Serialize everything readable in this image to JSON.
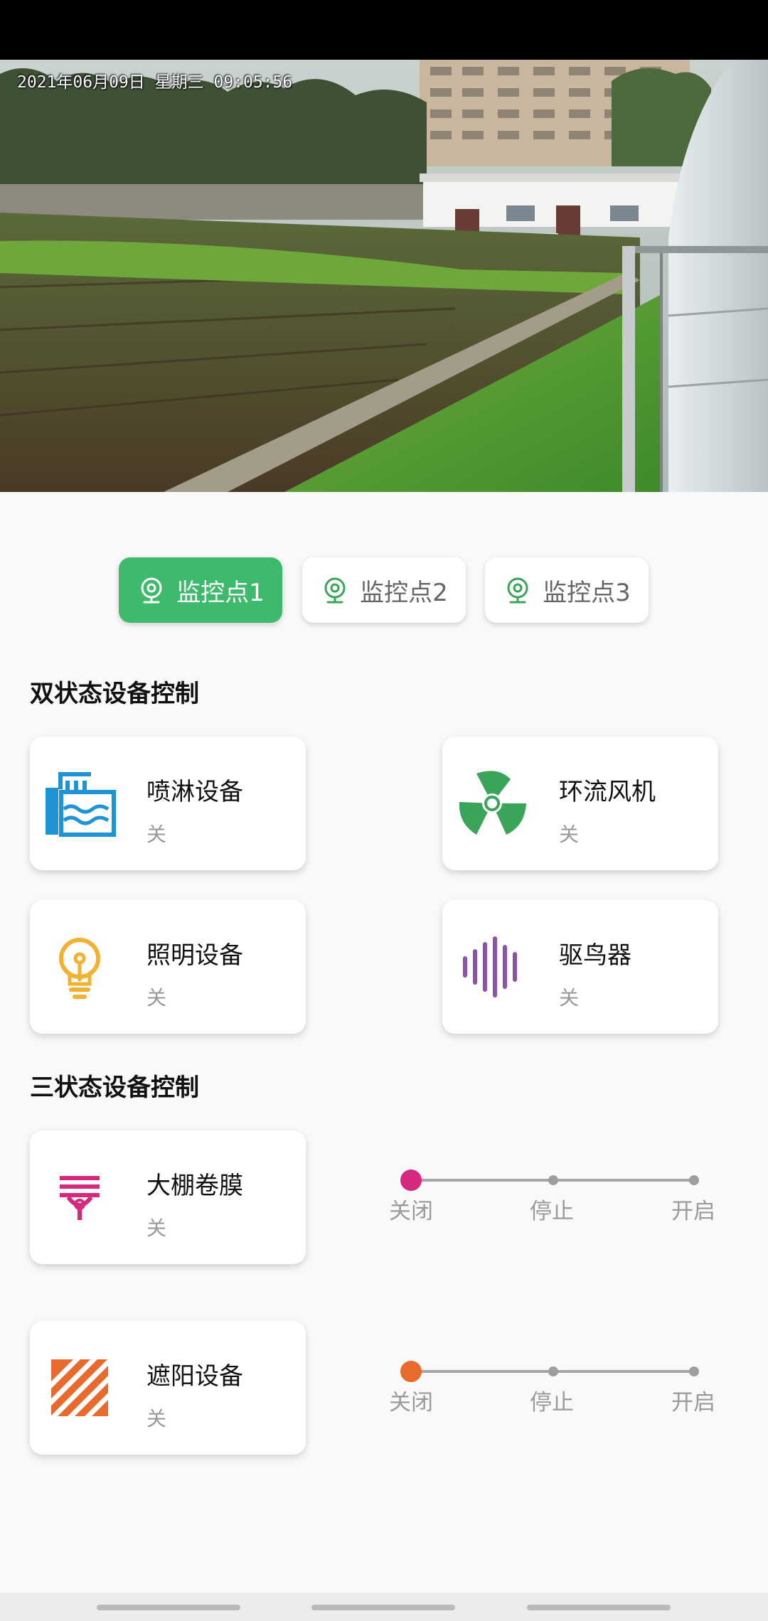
{
  "video": {
    "osd_timestamp": "2021年06月09日 星期三 09:05:56"
  },
  "camera_tabs": [
    {
      "label": "监控点1",
      "active": true,
      "icon": "webcam-icon"
    },
    {
      "label": "监控点2",
      "active": false,
      "icon": "webcam-icon"
    },
    {
      "label": "监控点3",
      "active": false,
      "icon": "webcam-icon"
    }
  ],
  "sections": {
    "two_state_title": "双状态设备控制",
    "three_state_title": "三状态设备控制"
  },
  "two_state_devices": [
    {
      "name": "喷淋设备",
      "state": "关",
      "icon": "sprinkler-icon",
      "color": "#1e93d6"
    },
    {
      "name": "环流风机",
      "state": "关",
      "icon": "fan-icon",
      "color": "#3aa559"
    },
    {
      "name": "照明设备",
      "state": "关",
      "icon": "lightbulb-icon",
      "color": "#f1b232"
    },
    {
      "name": "驱鸟器",
      "state": "关",
      "icon": "sound-wave-icon",
      "color": "#8a53a8"
    }
  ],
  "three_state_devices": [
    {
      "name": "大棚卷膜",
      "state": "关",
      "icon": "film-roll-icon",
      "color": "#d6297e",
      "options": [
        "关闭",
        "停止",
        "开启"
      ],
      "selected": "关闭"
    },
    {
      "name": "遮阳设备",
      "state": "关",
      "icon": "shade-icon",
      "color": "#e86a2c",
      "options": [
        "关闭",
        "停止",
        "开启"
      ],
      "selected": "关闭"
    }
  ],
  "colors": {
    "accent_green": "#3dba6b"
  }
}
